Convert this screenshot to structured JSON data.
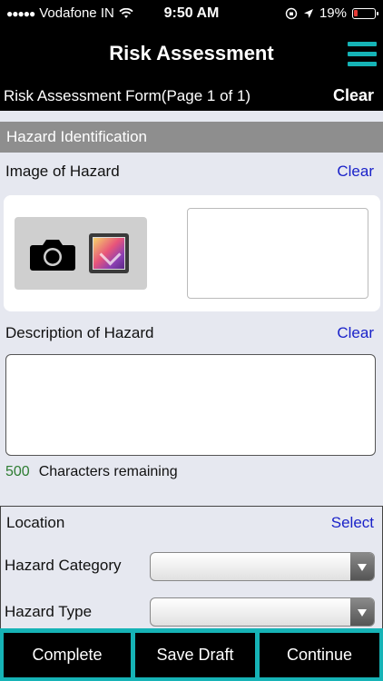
{
  "status_bar": {
    "carrier": "Vodafone IN",
    "time": "9:50 AM",
    "battery": "19%",
    "battery_level": 0.19
  },
  "nav": {
    "title": "Risk Assessment"
  },
  "form_header": {
    "title": "Risk Assessment Form(Page 1 of 1)",
    "clear_label": "Clear"
  },
  "hazard_identification": {
    "section_title": "Hazard Identification",
    "image_label": "Image of Hazard",
    "image_clear": "Clear",
    "description_label": "Description of Hazard",
    "description_clear": "Clear",
    "description_value": "",
    "char_count": "500",
    "char_remaining_label": "Characters remaining"
  },
  "location": {
    "label": "Location",
    "select_link": "Select",
    "hazard_category_label": "Hazard Category",
    "hazard_category_value": "",
    "hazard_type_label": "Hazard Type",
    "hazard_type_value": ""
  },
  "buttons": {
    "complete": "Complete",
    "save_draft": "Save Draft",
    "continue": "Continue"
  },
  "colors": {
    "accent_teal": "#16b3b6",
    "link_blue": "#1a22c9",
    "battery_red": "#e53935",
    "char_count_green": "#2e7d32"
  }
}
